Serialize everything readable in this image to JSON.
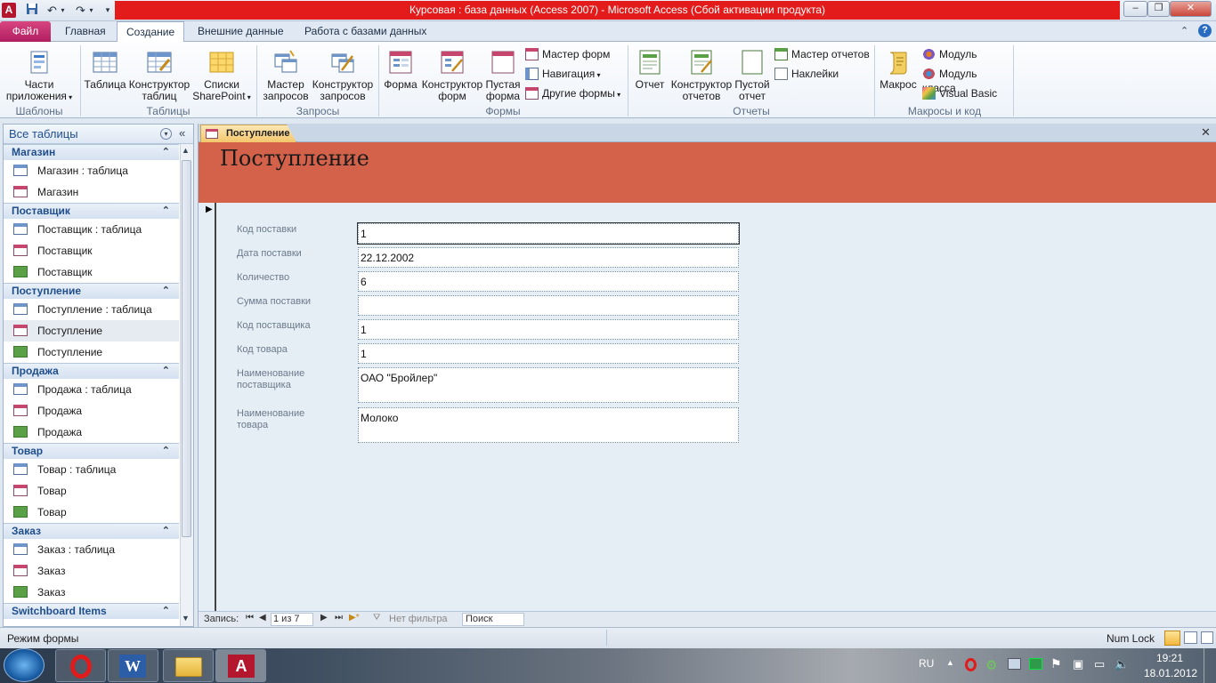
{
  "window": {
    "title": "Курсовая : база данных (Access 2007)  -  Microsoft Access (Сбой активации продукта)",
    "app_icon": "A"
  },
  "tabs": [
    "Файл",
    "Главная",
    "Создание",
    "Внешние данные",
    "Работа с базами данных"
  ],
  "active_tab": "Создание",
  "ribbon": {
    "templates": {
      "app_parts": "Части приложения",
      "group": "Шаблоны"
    },
    "tables": {
      "table": "Таблица",
      "designer": "Конструктор таблиц",
      "sharepoint": "Списки SharePoint",
      "group": "Таблицы"
    },
    "queries": {
      "wizard": "Мастер запросов",
      "designer": "Конструктор запросов",
      "group": "Запросы"
    },
    "forms": {
      "form": "Форма",
      "designer": "Конструктор форм",
      "blank": "Пустая форма",
      "wizard": "Мастер форм",
      "navigation": "Навигация",
      "other": "Другие формы",
      "group": "Формы"
    },
    "reports": {
      "report": "Отчет",
      "designer": "Конструктор отчетов",
      "blank": "Пустой отчет",
      "wizard": "Мастер отчетов",
      "labels": "Наклейки",
      "group": "Отчеты"
    },
    "macros": {
      "macro": "Макрос",
      "module": "Модуль",
      "class_module": "Модуль класса",
      "vba": "Visual Basic",
      "group": "Макросы и код"
    }
  },
  "nav": {
    "header": "Все таблицы",
    "groups": [
      {
        "name": "Магазин",
        "items": [
          {
            "type": "table",
            "label": "Магазин : таблица"
          },
          {
            "type": "form",
            "label": "Магазин"
          }
        ]
      },
      {
        "name": "Поставщик",
        "items": [
          {
            "type": "table",
            "label": "Поставщик : таблица"
          },
          {
            "type": "form",
            "label": "Поставщик"
          },
          {
            "type": "report",
            "label": "Поставщик"
          }
        ]
      },
      {
        "name": "Поступление",
        "items": [
          {
            "type": "table",
            "label": "Поступление : таблица"
          },
          {
            "type": "form",
            "label": "Поступление"
          },
          {
            "type": "report",
            "label": "Поступление"
          }
        ]
      },
      {
        "name": "Продажа",
        "items": [
          {
            "type": "table",
            "label": "Продажа : таблица"
          },
          {
            "type": "form",
            "label": "Продажа"
          },
          {
            "type": "report",
            "label": "Продажа"
          }
        ]
      },
      {
        "name": "Товар",
        "items": [
          {
            "type": "table",
            "label": "Товар : таблица"
          },
          {
            "type": "form",
            "label": "Товар"
          },
          {
            "type": "report",
            "label": "Товар"
          }
        ]
      },
      {
        "name": "Заказ",
        "items": [
          {
            "type": "table",
            "label": "Заказ : таблица"
          },
          {
            "type": "form",
            "label": "Заказ"
          },
          {
            "type": "report",
            "label": "Заказ"
          }
        ]
      },
      {
        "name": "Switchboard Items",
        "items": []
      }
    ],
    "selected": "Поступление"
  },
  "document": {
    "tab_label": "Поступление",
    "form_title": "Поступление",
    "fields": [
      {
        "label": "Код поставки",
        "value": "1"
      },
      {
        "label": "Дата поставки",
        "value": "22.12.2002"
      },
      {
        "label": "Количество",
        "value": "6"
      },
      {
        "label": "Сумма поставки",
        "value": ""
      },
      {
        "label": "Код  поставщика",
        "value": "1"
      },
      {
        "label": "Код товара",
        "value": "1"
      },
      {
        "label": "Наименование поставщика",
        "value": "ОАО \"Бройлер\""
      },
      {
        "label": "Наименование товара",
        "value": "Молоко"
      }
    ],
    "record_bar": {
      "label": "Запись:",
      "position": "1 из 7",
      "filter": "Нет фильтра",
      "search": "Поиск"
    }
  },
  "status": {
    "left": "Режим формы",
    "numlock": "Num Lock"
  },
  "taskbar": {
    "lang": "RU",
    "time": "19:21",
    "date": "18.01.2012"
  }
}
